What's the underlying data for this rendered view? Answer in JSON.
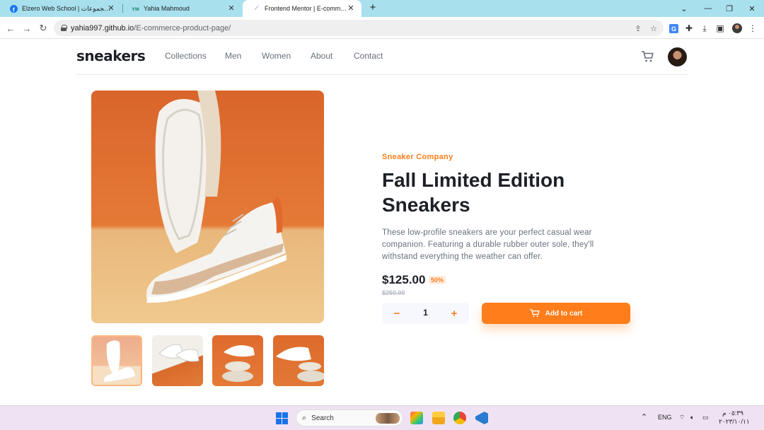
{
  "browser": {
    "tabs": [
      {
        "title": "Elzero Web School | المجموعات |",
        "icon": "facebook-icon",
        "active": false
      },
      {
        "title": "Yahia Mahmoud",
        "icon": "ym-logo-icon",
        "active": false
      },
      {
        "title": "Frontend Mentor | E-commerce",
        "icon": "frontend-mentor-icon",
        "active": true
      }
    ],
    "url_host": "yahia997.github.io",
    "url_path": "/E-commerce-product-page/"
  },
  "site": {
    "logo": "sneakers",
    "nav": [
      "Collections",
      "Men",
      "Women",
      "About",
      "Contact"
    ]
  },
  "product": {
    "company": "Sneaker Company",
    "title": "Fall Limited Edition Sneakers",
    "description": "These low-profile sneakers are your perfect casual wear companion. Featuring a durable rubber outer sole, they'll withstand everything the weather can offer.",
    "price": "$125.00",
    "discount": "50%",
    "old_price": "$250.00",
    "quantity": "1",
    "add_to_cart": "Add to cart",
    "accent_color": "#ff7e1b",
    "thumbnail_count": 4,
    "selected_thumbnail": 1
  },
  "taskbar": {
    "search": "Search",
    "language": "ENG",
    "time": "٠٥:٣٩ م",
    "date": "٢٠٢٣/١٠/١١"
  }
}
